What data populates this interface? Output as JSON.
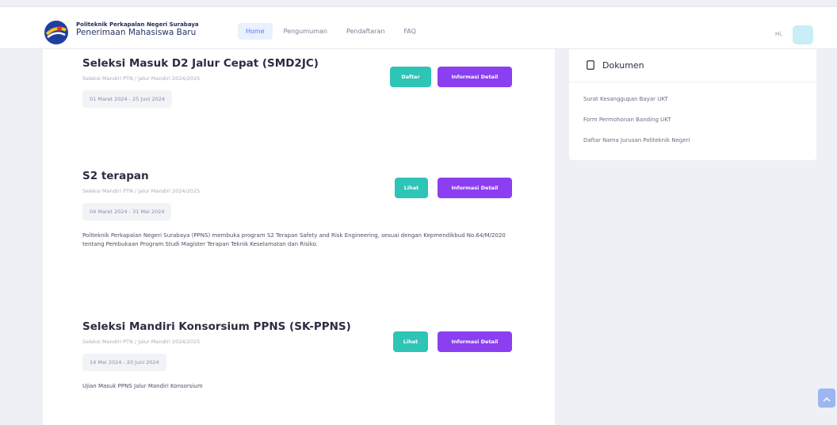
{
  "header": {
    "brand_title": "Politeknik Perkapalan Negeri Surabaya",
    "brand_subtitle": "Penerimaan Mahasiswa Baru",
    "nav": [
      {
        "label": "Home",
        "active": true
      },
      {
        "label": "Pengumuman",
        "active": false
      },
      {
        "label": "Pendaftaran",
        "active": false
      },
      {
        "label": "FAQ",
        "active": false
      }
    ],
    "greeting": "Hi,",
    "logo_icon": "ppns-logo-icon"
  },
  "items": [
    {
      "title": "Seleksi Masuk D2 Jalur Cepat (SMD2JC)",
      "meta": "Seleksi Mandiri PTN / Jalur Mandiri 2024/2025",
      "date": "01 Maret 2024 - 25 Juni 2024",
      "primary_button": "Daftar",
      "detail_button": "Informasi Detail"
    },
    {
      "title": "S2 terapan",
      "meta": "Seleksi Mandiri PTN / Jalur Mandiri 2024/2025",
      "date": "04 Maret 2024 - 31 Mei 2024",
      "description": "Politeknik Perkapalan Negeri Surabaya (PPNS) membuka program S2 Terapan Safety and Risk Engineering, sesuai dengan Kepmendikbud No.64/M/2020 tentang Pembukaan Program Studi Magister Terapan Teknik Keselamatan dan Risiko.",
      "primary_button": "Lihat",
      "detail_button": "Informasi Detail"
    },
    {
      "title": "Seleksi Mandiri Konsorsium PPNS (SK-PPNS)",
      "meta": "Seleksi Mandiri PTN / Jalur Mandiri 2024/2025",
      "date": "14 Mei 2024 - 20 Juni 2024",
      "description": "Ujian Masuk PPNS Jalur Mandiri Konsorsium",
      "primary_button": "Lihat",
      "detail_button": "Informasi Detail"
    }
  ],
  "sidebar": {
    "title": "Dokumen",
    "icon": "document-icon",
    "links": [
      "Surat Kesanggupan Bayar UKT",
      "Form Permohonan Banding UKT",
      "Daftar Nama Jurusan Politeknik Negeri"
    ]
  },
  "colors": {
    "teal": "#2ec4b6",
    "purple": "#8b3ff0",
    "nav_active": "#4f7cff",
    "background": "#eef0f5"
  }
}
